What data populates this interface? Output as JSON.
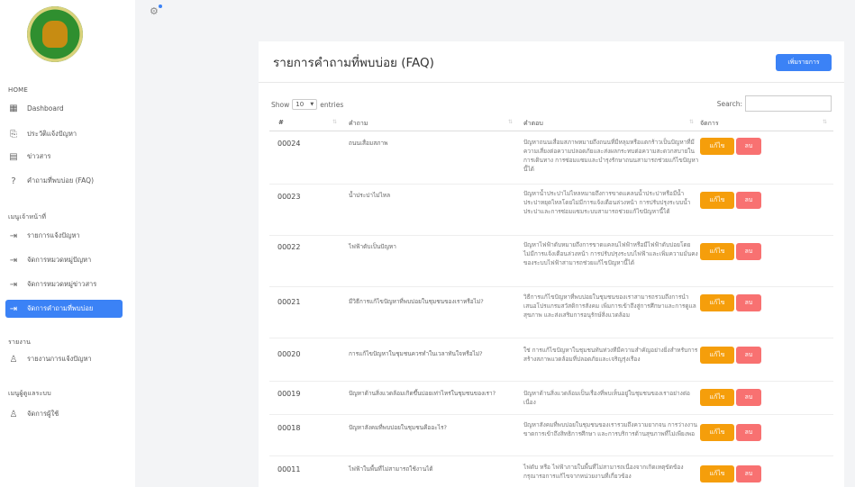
{
  "sidebar": {
    "sections": [
      "HOME",
      "เมนูเจ้าหน้าที่",
      "รายงาน",
      "เมนูผู้ดูแลระบบ"
    ],
    "items": [
      {
        "icon": "dashboard-icon",
        "label": "Dashboard",
        "active": false
      },
      {
        "icon": "history-icon",
        "label": "ประวัติแจ้งปัญหา",
        "active": false
      },
      {
        "icon": "news-icon",
        "label": "ข่าวสาร",
        "active": false
      },
      {
        "icon": "question-icon",
        "label": "คำถามที่พบบ่อย (FAQ)",
        "active": false
      },
      {
        "icon": "list-icon",
        "label": "รายการแจ้งปัญหา",
        "active": false
      },
      {
        "icon": "list-icon",
        "label": "จัดการหมวดหมู่ปัญหา",
        "active": false
      },
      {
        "icon": "list-icon",
        "label": "จัดการหมวดหมู่ข่าวสาร",
        "active": false
      },
      {
        "icon": "list-icon",
        "label": "จัดการคำถามที่พบบ่อย",
        "active": true
      },
      {
        "icon": "user-icon",
        "label": "รายงานการแจ้งปัญหา",
        "active": false
      },
      {
        "icon": "user-icon",
        "label": "จัดการผู้ใช้",
        "active": false
      }
    ]
  },
  "main": {
    "title": "รายการคำถามที่พบบ่อย (FAQ)",
    "add_button": "เพิ่มรายการ",
    "show_label": "Show",
    "show_value": "10",
    "entries_label": "entries",
    "search_label": "Search:",
    "columns": [
      "#",
      "คำถาม",
      "คำตอบ",
      "จัดการ"
    ],
    "edit_label": "แก้ไข",
    "delete_label": "ลบ",
    "rows": [
      {
        "id": "00024",
        "question": "ถนนเสื่อมสภาพ",
        "answer": "ปัญหาถนนเสื่อมสภาพหมายถึงถนนที่มีหลุมหรือแตกร้าวเป็นปัญหาที่มีความเสี่ยงต่อความปลอดภัยและส่งผลกระทบต่อความสะดวกสบายในการเดินทาง การซ่อมแซมและบำรุงรักษาถนนสามารถช่วยแก้ไขปัญหานี้ได้"
      },
      {
        "id": "00023",
        "question": "น้ำประปาไม่ไหล",
        "answer": "ปัญหาน้ำประปาไม่ไหลหมายถึงการขาดแคลนน้ำประปาหรือมีน้ำประปาหยุดไหลโดยไม่มีการแจ้งเตือนล่วงหน้า การปรับปรุงระบบน้ำประปาและการซ่อมแซมระบบสามารถช่วยแก้ไขปัญหานี้ได้"
      },
      {
        "id": "00022",
        "question": "ไฟฟ้าดับเป็นปัญหา",
        "answer": "ปัญหาไฟฟ้าดับหมายถึงการขาดแคลนไฟฟ้าหรือมีไฟฟ้าดับบ่อยโดยไม่มีการแจ้งเตือนล่วงหน้า การปรับปรุงระบบไฟฟ้าและเพิ่มความมั่นคงของระบบไฟฟ้าสามารถช่วยแก้ไขปัญหานี้ได้"
      },
      {
        "id": "00021",
        "question": "มีวิธีการแก้ไขปัญหาที่พบบ่อยในชุมชนของเราหรือไม่?",
        "answer": "วิธีการแก้ไขปัญหาที่พบบ่อยในชุมชนของเราสามารถรวมถึงการนำเสนอโปรแกรมสวัสดิการสังคม เพิ่มการเข้าถึงสู่การศึกษาและการดูแลสุขภาพ และส่งเสริมการอนุรักษ์สิ่งแวดล้อม"
      },
      {
        "id": "00020",
        "question": "การแก้ไขปัญหาในชุมชนควรทำในเวลาทันใจหรือไม่?",
        "answer": "ใช่ การแก้ไขปัญหาในชุมชนทันท่วงทีมีความสำคัญอย่างยิ่งสำหรับการสร้างสภาพแวดล้อมที่ปลอดภัยและเจริญรุ่งเรือง"
      },
      {
        "id": "00019",
        "question": "ปัญหาด้านสิ่งแวดล้อมเกิดขึ้นบ่อยเท่าไหร่ในชุมชนของเรา?",
        "answer": "ปัญหาด้านสิ่งแวดล้อมเป็นเรื่องที่พบเห็นอยู่ในชุมชนของเราอย่างต่อเนื่อง"
      },
      {
        "id": "00018",
        "question": "ปัญหาสังคมที่พบบ่อยในชุมชนคืออะไร?",
        "answer": "ปัญหาสังคมที่พบบ่อยในชุมชนของเรารวมถึงความยากจน การว่างงาน ขาดการเข้าถึงสิทธิการศึกษา และการบริการด้านสุขภาพที่ไม่เพียงพอ"
      },
      {
        "id": "00011",
        "question": "ไฟฟ้าในพื้นที่ไม่สามารถใช้งานได้",
        "answer": "ไฟดับ หรือ ไฟฟ้าภายในพื้นที่ไม่สามารถเนื่องจากเกิดเหตุขัดข้อง กรุณารอการแก้ไขจากหน่วยงานที่เกี่ยวข้อง"
      }
    ]
  }
}
